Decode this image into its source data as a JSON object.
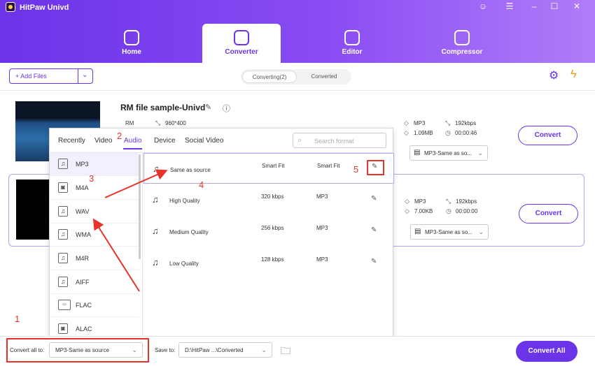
{
  "app": {
    "title": "HitPaw Univd"
  },
  "window_controls": [
    "☺",
    "☰",
    "–",
    "☐",
    "✕"
  ],
  "main_tabs": [
    {
      "label": "Home"
    },
    {
      "label": "Converter"
    },
    {
      "label": "Editor"
    },
    {
      "label": "Compressor"
    }
  ],
  "toolbar": {
    "add_files": "+ Add Files",
    "add_files_dropdown": "⌄",
    "subtabs": [
      "Converting(2)",
      "Converted"
    ]
  },
  "toolbar_icons": [
    "gpu-on-icon",
    "lightning-on-icon"
  ],
  "files": [
    {
      "name": "RM file sample-Univd",
      "source_format": "RM",
      "resolution": "960*400",
      "target_format": "MP3",
      "bitrate": "192kbps",
      "size": "1.09MB",
      "duration": "00:00:46",
      "select_value": "MP3-Same as so...",
      "convert": "Convert"
    },
    {
      "name": "",
      "target_format": "MP3",
      "bitrate": "192kbps",
      "size": "7.00KB",
      "duration": "00:00:00",
      "select_value": "MP3-Same as so...",
      "convert": "Convert"
    }
  ],
  "format_popup": {
    "tabs": [
      "Recently",
      "Video",
      "Audio",
      "Device",
      "Social Video"
    ],
    "active_tab": "Audio",
    "search_placeholder": "Search format",
    "formats": [
      "MP3",
      "M4A",
      "WAV",
      "WMA",
      "M4R",
      "AIFF",
      "FLAC",
      "ALAC"
    ],
    "selected_format": "MP3",
    "qualities": [
      {
        "name": "Same as source",
        "bitrate": "Smart Fit",
        "format": "Smart Fit"
      },
      {
        "name": "High Quality",
        "bitrate": "320 kbps",
        "format": "MP3"
      },
      {
        "name": "Medium Quality",
        "bitrate": "256 kbps",
        "format": "MP3"
      },
      {
        "name": "Low Quality",
        "bitrate": "128 kbps",
        "format": "MP3"
      }
    ]
  },
  "bottom_bar": {
    "convert_all_to_label": "Convert all to:",
    "convert_all_to_value": "MP3-Same as source",
    "save_to_label": "Save to:",
    "save_to_value": "D:\\HitPaw ...\\Converted",
    "convert_all": "Convert All"
  },
  "annotations": [
    "1",
    "2",
    "3",
    "4",
    "5"
  ],
  "colors": {
    "accent": "#6b34e8",
    "annotation": "#e8322b"
  }
}
